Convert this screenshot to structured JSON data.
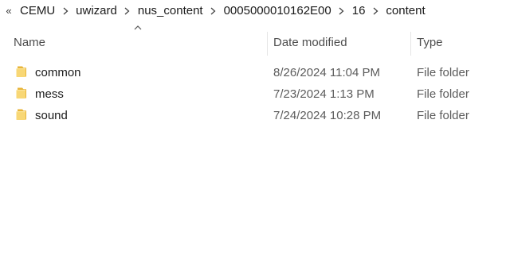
{
  "breadcrumb": {
    "overflow_glyph": "«",
    "items": [
      {
        "label": "CEMU"
      },
      {
        "label": "uwizard"
      },
      {
        "label": "nus_content"
      },
      {
        "label": "0005000010162E00"
      },
      {
        "label": "16"
      },
      {
        "label": "content"
      }
    ]
  },
  "columns": {
    "name": "Name",
    "date": "Date modified",
    "type": "Type"
  },
  "sort": {
    "column": "name",
    "direction": "ascending"
  },
  "files": [
    {
      "name": "common",
      "date": "8/26/2024 11:04 PM",
      "type": "File folder",
      "icon": "folder-icon"
    },
    {
      "name": "mess",
      "date": "7/23/2024 1:13 PM",
      "type": "File folder",
      "icon": "folder-icon"
    },
    {
      "name": "sound",
      "date": "7/24/2024 10:28 PM",
      "type": "File folder",
      "icon": "folder-icon"
    }
  ],
  "colors": {
    "folder_front": "#f8d775",
    "folder_back": "#e8b53a",
    "header_text": "#4d4d4d",
    "secondary_text": "#5c5c5c"
  }
}
